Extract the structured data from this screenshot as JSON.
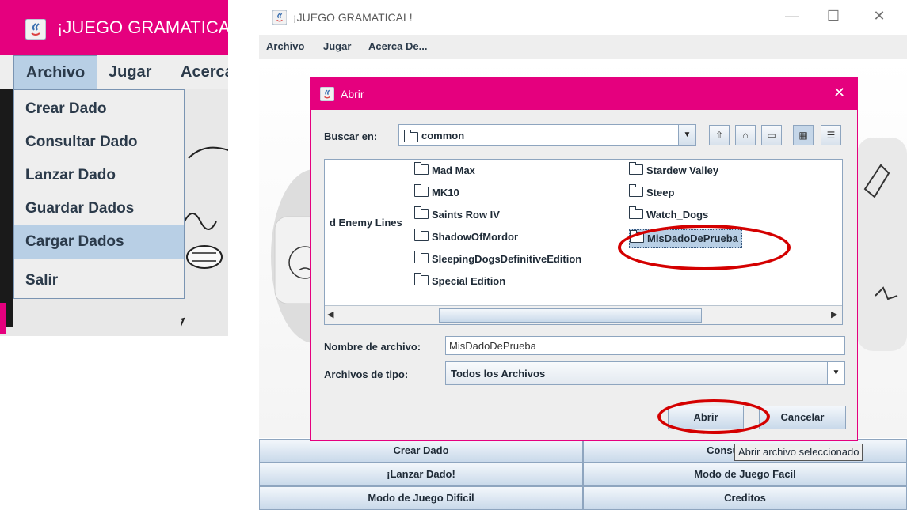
{
  "zoom_panel": {
    "title": "¡JUEGO GRAMATICAL!",
    "menu": [
      "Archivo",
      "Jugar",
      "Acerca De..."
    ],
    "dropdown_items": [
      "Crear Dado",
      "Consultar Dado",
      "Lanzar Dado",
      "Guardar Dados",
      "Cargar Dados",
      "Salir"
    ],
    "selected_item": "Cargar Dados"
  },
  "window": {
    "title": "¡JUEGO GRAMATICAL!",
    "controls": {
      "minimize": "—",
      "maximize": "☐",
      "close": "✕"
    },
    "menu": [
      "Archivo",
      "Jugar",
      "Acerca De..."
    ]
  },
  "dialog": {
    "title": "Abrir",
    "close": "✕",
    "look_in_label": "Buscar en:",
    "look_in_value": "common",
    "files_col1": [
      "Mad Max",
      "MK10",
      "Saints Row IV",
      "ShadowOfMordor",
      "SleepingDogsDefinitiveEdition",
      "Special Edition"
    ],
    "partial_left": "d Enemy Lines",
    "files_col2": [
      "Stardew Valley",
      "Steep",
      "Watch_Dogs",
      "MisDadoDePrueba"
    ],
    "selected_file": "MisDadoDePrueba",
    "filename_label": "Nombre de archivo:",
    "filename_value": "MisDadoDePrueba",
    "filetype_label": "Archivos de tipo:",
    "filetype_value": "Todos los Archivos",
    "open_button": "Abrir",
    "cancel_button": "Cancelar",
    "tooltip": "Abrir archivo seleccionado"
  },
  "bottom_buttons": [
    "Crear Dado",
    "Consultar Dado",
    "¡Lanzar Dado!",
    "Modo de Juego Facil",
    "Modo de Juego Dificil",
    "Creditos"
  ],
  "colors": {
    "accent": "#e5007e",
    "selection": "#b8cfe5",
    "annotation": "#d40000"
  }
}
